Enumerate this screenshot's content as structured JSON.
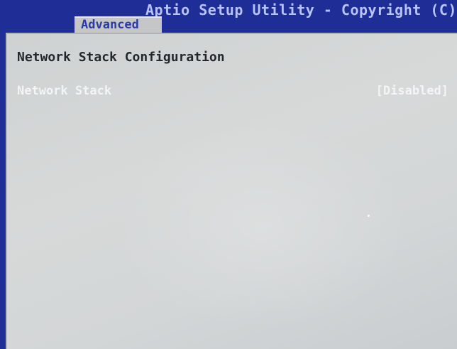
{
  "header": {
    "title": "Aptio Setup Utility - Copyright (C)",
    "tabs": [
      {
        "label": "Advanced",
        "active": true
      }
    ]
  },
  "main": {
    "section_title": "Network Stack Configuration",
    "settings": [
      {
        "label": "Network Stack",
        "value": "[Disabled]"
      }
    ]
  },
  "colors": {
    "frame_blue": "#1f2d97",
    "panel_gray": "#d3d6d7",
    "tab_gray": "#c4c6c8",
    "text_dark": "#24282c",
    "text_white": "#f2f4f5"
  }
}
